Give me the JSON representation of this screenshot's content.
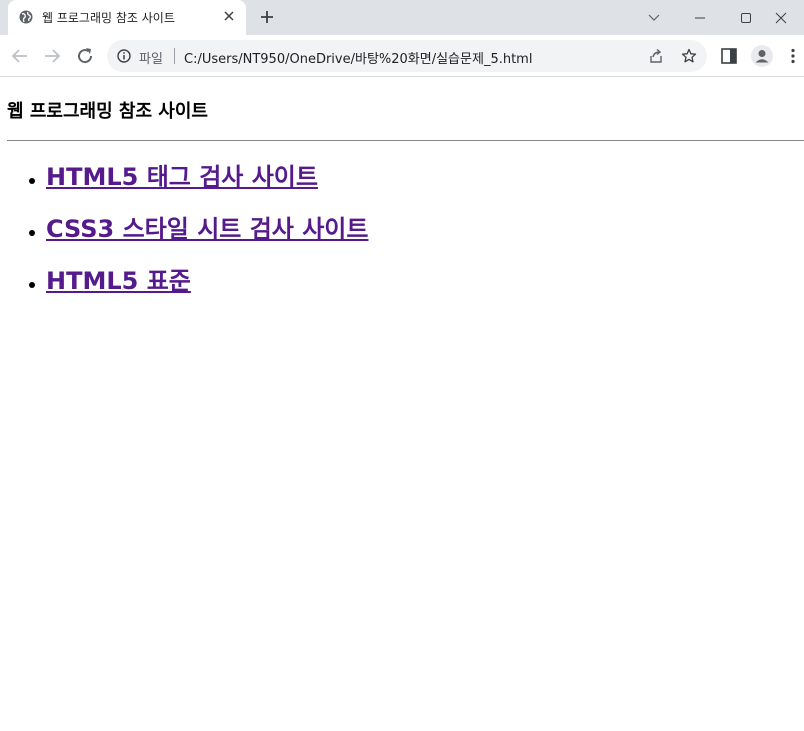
{
  "browser": {
    "tab_title": "웹 프로그래밍 참조 사이트",
    "scheme_label": "파일",
    "url": "C:/Users/NT950/OneDrive/바탕%20화면/실습문제_5.html"
  },
  "page": {
    "heading": "웹 프로그래밍 참조 사이트",
    "links": [
      {
        "label": "HTML5 태그 검사 사이트"
      },
      {
        "label": "CSS3 스타일 시트 검사 사이트"
      },
      {
        "label": "HTML5 표준"
      }
    ]
  },
  "colors": {
    "visited_link": "#551a8b",
    "tabstrip": "#dee1e6",
    "omnibox": "#f1f3f4"
  }
}
